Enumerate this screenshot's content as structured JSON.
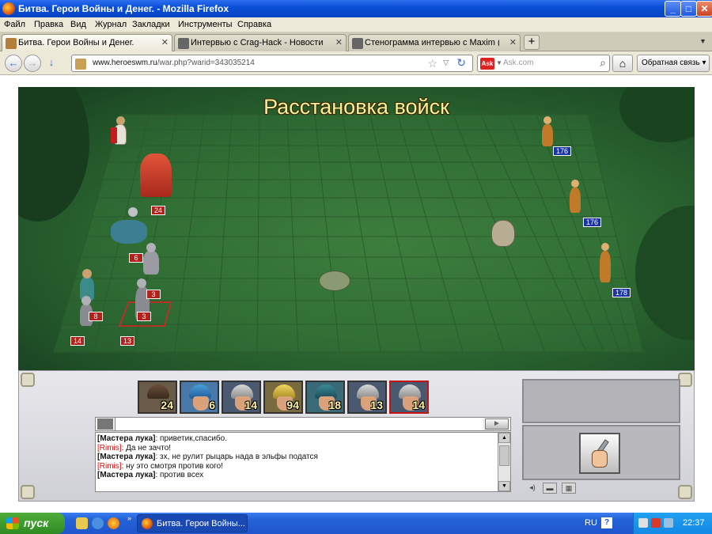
{
  "window": {
    "title": "Битва. Герои Войны и Денег. - Mozilla Firefox",
    "minimize_glyph": "_",
    "maximize_glyph": "□",
    "close_glyph": "✕"
  },
  "menu": [
    "Файл",
    "Правка",
    "Вид",
    "Журнал",
    "Закладки",
    "Инструменты",
    "Справка"
  ],
  "tabs": [
    {
      "label": "Битва. Герои Войны и Денег.",
      "active": true
    },
    {
      "label": "Интервью с Crag-Hack - Новости - HW...",
      "active": false
    },
    {
      "label": "Стенограмма интервью с Maxim (adm)....",
      "active": false
    }
  ],
  "tab_close_glyph": "✕",
  "new_tab_glyph": "+",
  "tab_list_glyph": "▼",
  "nav": {
    "back_glyph": "←",
    "forward_glyph": "→",
    "download_glyph": "↓",
    "url_host": "www.heroeswm.ru",
    "url_path": "/war.php?warid=343035214",
    "bookmark_glyph": "☆",
    "dropdown_glyph": "▽",
    "reload_glyph": "↻",
    "search_engine": "Ask",
    "search_engine_dropdown_glyph": "▼",
    "search_placeholder": "Ask.com",
    "search_glyph": "⌕",
    "home_glyph": "⌂",
    "feedback_label": "Обратная связь ▾"
  },
  "battle": {
    "title": "Расстановка войск",
    "left_stacks": [
      {
        "name": "cavalry",
        "count": "6"
      },
      {
        "name": "griffin",
        "count": "24"
      },
      {
        "name": "archer-stack-a",
        "count": "14"
      },
      {
        "name": "archer-stack-b",
        "count": "13"
      },
      {
        "name": "footman",
        "count": "8"
      },
      {
        "name": "footman-b",
        "count": "3"
      },
      {
        "name": "footman-c",
        "count": "3"
      }
    ],
    "right_stacks": [
      {
        "name": "elf-archer-1",
        "count": "176"
      },
      {
        "name": "elf-archer-2",
        "count": "176"
      },
      {
        "name": "elf-archer-3",
        "count": "178"
      }
    ]
  },
  "army_bar": [
    {
      "name": "unit-slot-1",
      "count": "24",
      "selected": false
    },
    {
      "name": "unit-slot-2",
      "count": "6",
      "selected": false
    },
    {
      "name": "unit-slot-3",
      "count": "14",
      "selected": false
    },
    {
      "name": "unit-slot-4",
      "count": "94",
      "selected": false
    },
    {
      "name": "unit-slot-5",
      "count": "18",
      "selected": false
    },
    {
      "name": "unit-slot-6",
      "count": "13",
      "selected": false
    },
    {
      "name": "unit-slot-7",
      "count": "14",
      "selected": true
    }
  ],
  "chat": {
    "send_glyph": "►",
    "scroll_up_glyph": "▲",
    "scroll_down_glyph": "▼",
    "messages": [
      {
        "nick": "[Мастера лука]",
        "nick_style": "bold",
        "text": ":  приветик,спасибо."
      },
      {
        "nick": "[Rimis]",
        "nick_style": "red",
        "text": ": Да не зачто!"
      },
      {
        "nick": "[Мастера лука]",
        "nick_style": "bold",
        "text": ":  зх, не рулит рыцарь нада в эльфы податся"
      },
      {
        "nick": "[Rimis]",
        "nick_style": "red",
        "text": ": ну это смотря против кого!"
      },
      {
        "nick": "[Мастера лука]",
        "nick_style": "bold",
        "text": ":  против всех"
      }
    ]
  },
  "panel_tools": {
    "sound_glyph": "◂)",
    "window_glyph": "▬",
    "grid_glyph": "▦"
  },
  "taskbar": {
    "start_label": "пуск",
    "quicklaunch_more": "»",
    "task_firefox_label": "Битва. Герои Войны...",
    "language": "RU",
    "help_glyph": "?",
    "clock": "22:37"
  }
}
